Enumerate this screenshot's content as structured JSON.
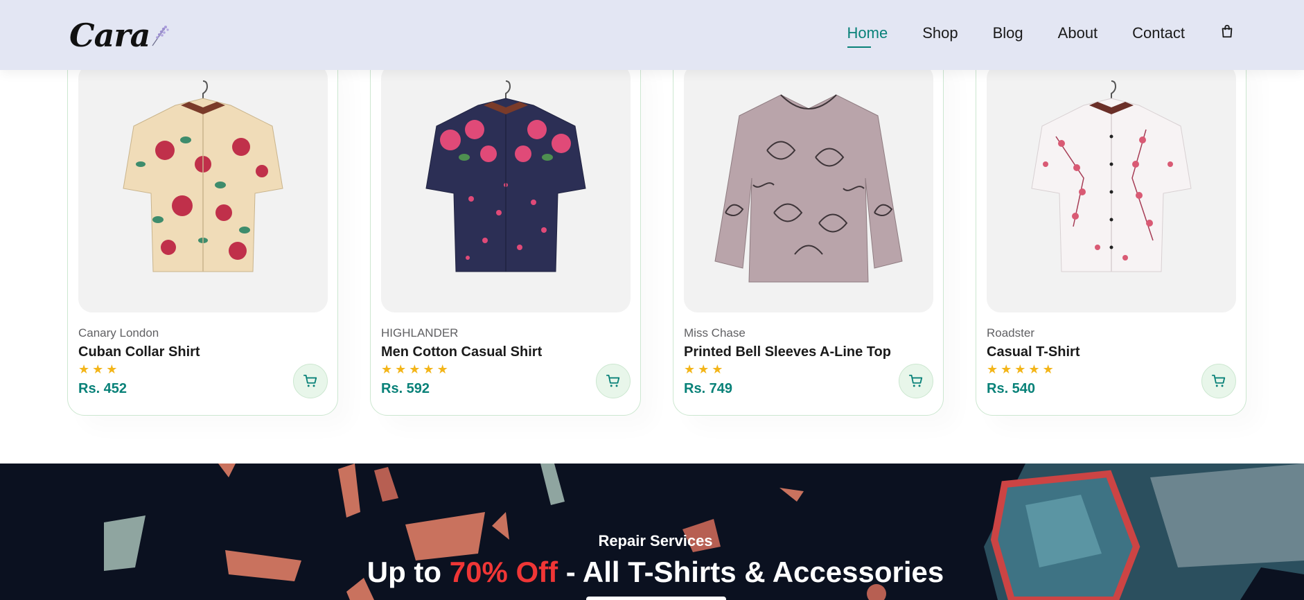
{
  "header": {
    "logo": "Cara",
    "nav": [
      {
        "label": "Home",
        "active": true
      },
      {
        "label": "Shop",
        "active": false
      },
      {
        "label": "Blog",
        "active": false
      },
      {
        "label": "About",
        "active": false
      },
      {
        "label": "Contact",
        "active": false
      }
    ],
    "bag_icon": "shopping-bag-icon"
  },
  "products": [
    {
      "brand": "Canary London",
      "name": "Cuban Collar Shirt",
      "rating": 3,
      "price": "Rs. 452",
      "shirt_colors": [
        "#f0dcb8",
        "#c0304a",
        "#3e8c6c"
      ]
    },
    {
      "brand": "HIGHLANDER",
      "name": "Men Cotton Casual Shirt",
      "rating": 5,
      "price": "Rs. 592",
      "shirt_colors": [
        "#2c2f55",
        "#e04a78",
        "#4e8f50"
      ]
    },
    {
      "brand": "Miss Chase",
      "name": "Printed Bell Sleeves A-Line Top",
      "rating": 3,
      "price": "Rs. 749",
      "shirt_colors": [
        "#b9a4aa",
        "#3d3438",
        "#8e7b80"
      ]
    },
    {
      "brand": "Roadster",
      "name": "Casual T-Shirt",
      "rating": 5,
      "price": "Rs. 540",
      "shirt_colors": [
        "#f7f3f4",
        "#d95a74",
        "#a63c55"
      ]
    }
  ],
  "banner": {
    "subtitle": "Repair Services",
    "title_prefix": "Up to ",
    "title_highlight": "70% Off",
    "title_suffix": " - All T-Shirts & Accessories"
  },
  "colors": {
    "accent": "#088178",
    "header_bg": "#e3e6f3",
    "star": "#f3b519",
    "banner_bg": "#0b1120",
    "highlight_red": "#ef3636"
  }
}
